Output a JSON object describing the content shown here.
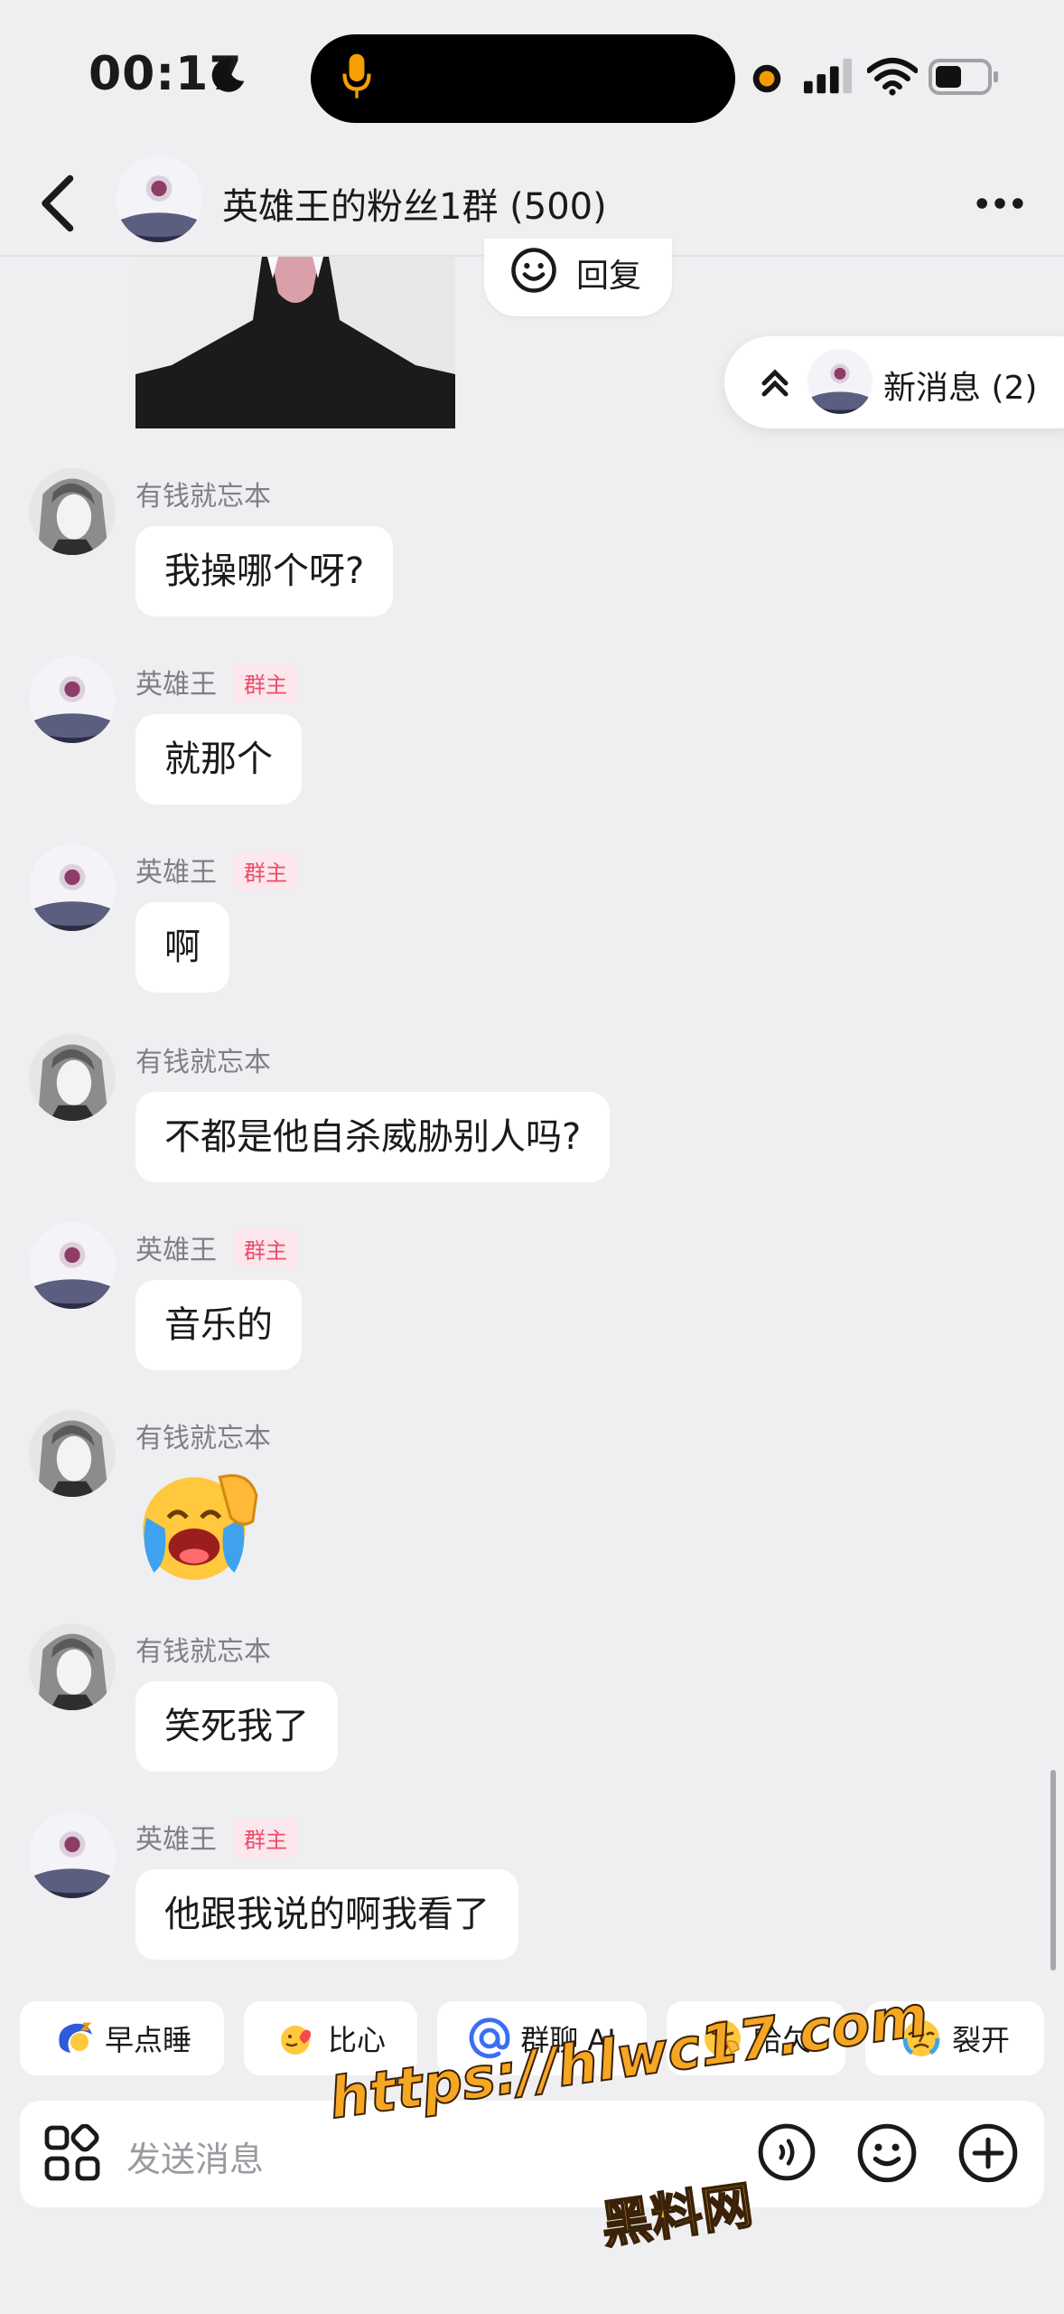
{
  "status_bar": {
    "time": "00:17"
  },
  "header": {
    "title": "英雄王的粉丝1群 (500)"
  },
  "reply_button": {
    "label": "回复"
  },
  "new_messages": {
    "label": "新消息 (2)"
  },
  "messages": [
    {
      "sender": "有钱就忘本",
      "badge": "",
      "text": "我操哪个呀?"
    },
    {
      "sender": "英雄王",
      "badge": "群主",
      "text": "就那个"
    },
    {
      "sender": "英雄王",
      "badge": "群主",
      "text": "啊"
    },
    {
      "sender": "有钱就忘本",
      "badge": "",
      "text": "不都是他自杀威胁别人吗?"
    },
    {
      "sender": "英雄王",
      "badge": "群主",
      "text": "音乐的"
    },
    {
      "sender": "有钱就忘本",
      "badge": "",
      "text": ""
    },
    {
      "sender": "有钱就忘本",
      "badge": "",
      "text": "笑死我了"
    },
    {
      "sender": "英雄王",
      "badge": "群主",
      "text": "他跟我说的啊我看了"
    }
  ],
  "quick_replies": [
    {
      "label": "早点睡",
      "icon": "sleep-moon-icon"
    },
    {
      "label": "比心",
      "icon": "heart-hands-icon"
    },
    {
      "label": "群聊 AI",
      "icon": "at-icon"
    },
    {
      "label": "哈欠",
      "icon": "yawn-icon"
    },
    {
      "label": "裂开",
      "icon": "cracked-face-icon"
    }
  ],
  "input": {
    "placeholder": "发送消息"
  },
  "watermark": {
    "url": "https://hlwc17.com",
    "name": "黑料网"
  },
  "colors": {
    "badge_text": "#ef4b6c",
    "badge_bg": "#fbe7ec",
    "background": "#efeff1",
    "watermark": "#f5a623"
  }
}
